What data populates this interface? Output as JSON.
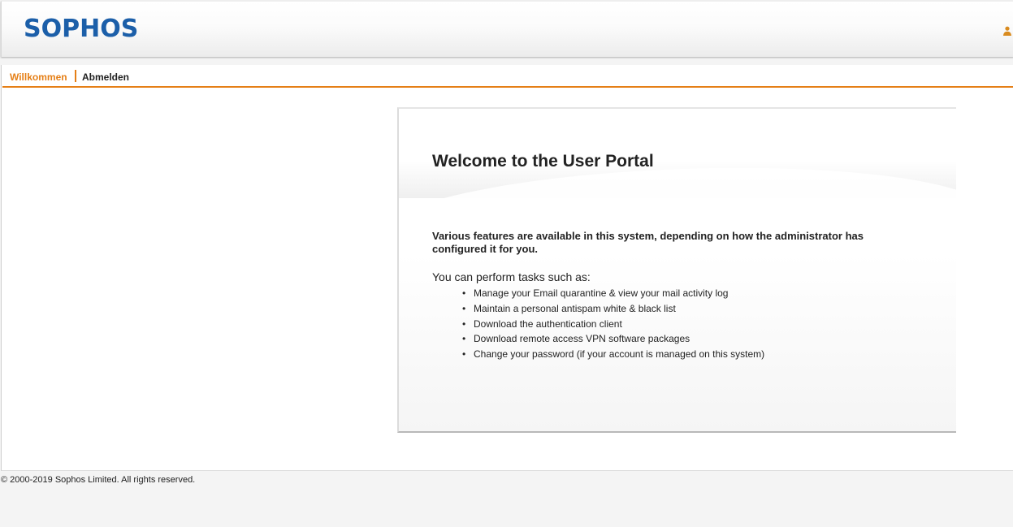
{
  "header": {
    "logo_text": "SOPHOS",
    "user_icon": "user-icon"
  },
  "navigation": {
    "items": [
      {
        "label": "Willkommen",
        "active": true
      },
      {
        "label": "Abmelden",
        "active": false
      }
    ]
  },
  "welcome_card": {
    "title_prefix": "Welcome to the ",
    "title_emphasis": "User Portal",
    "feature_note": "Various features are available in this system, depending on how the administrator has configured it for you.",
    "tasks_intro": "You can perform tasks such as:",
    "tasks": [
      "Manage your Email quarantine & view your mail activity log",
      "Maintain a personal antispam white & black list",
      "Download the authentication client",
      "Download remote access VPN software packages",
      "Change your password (if your account is managed on this system)"
    ]
  },
  "footer": {
    "copyright": "© 2000-2019 Sophos Limited. All rights reserved."
  },
  "colors": {
    "brand_blue": "#1c5fa9",
    "accent_orange": "#e57f16",
    "text_dark": "#222222",
    "background": "#f4f4f4"
  }
}
